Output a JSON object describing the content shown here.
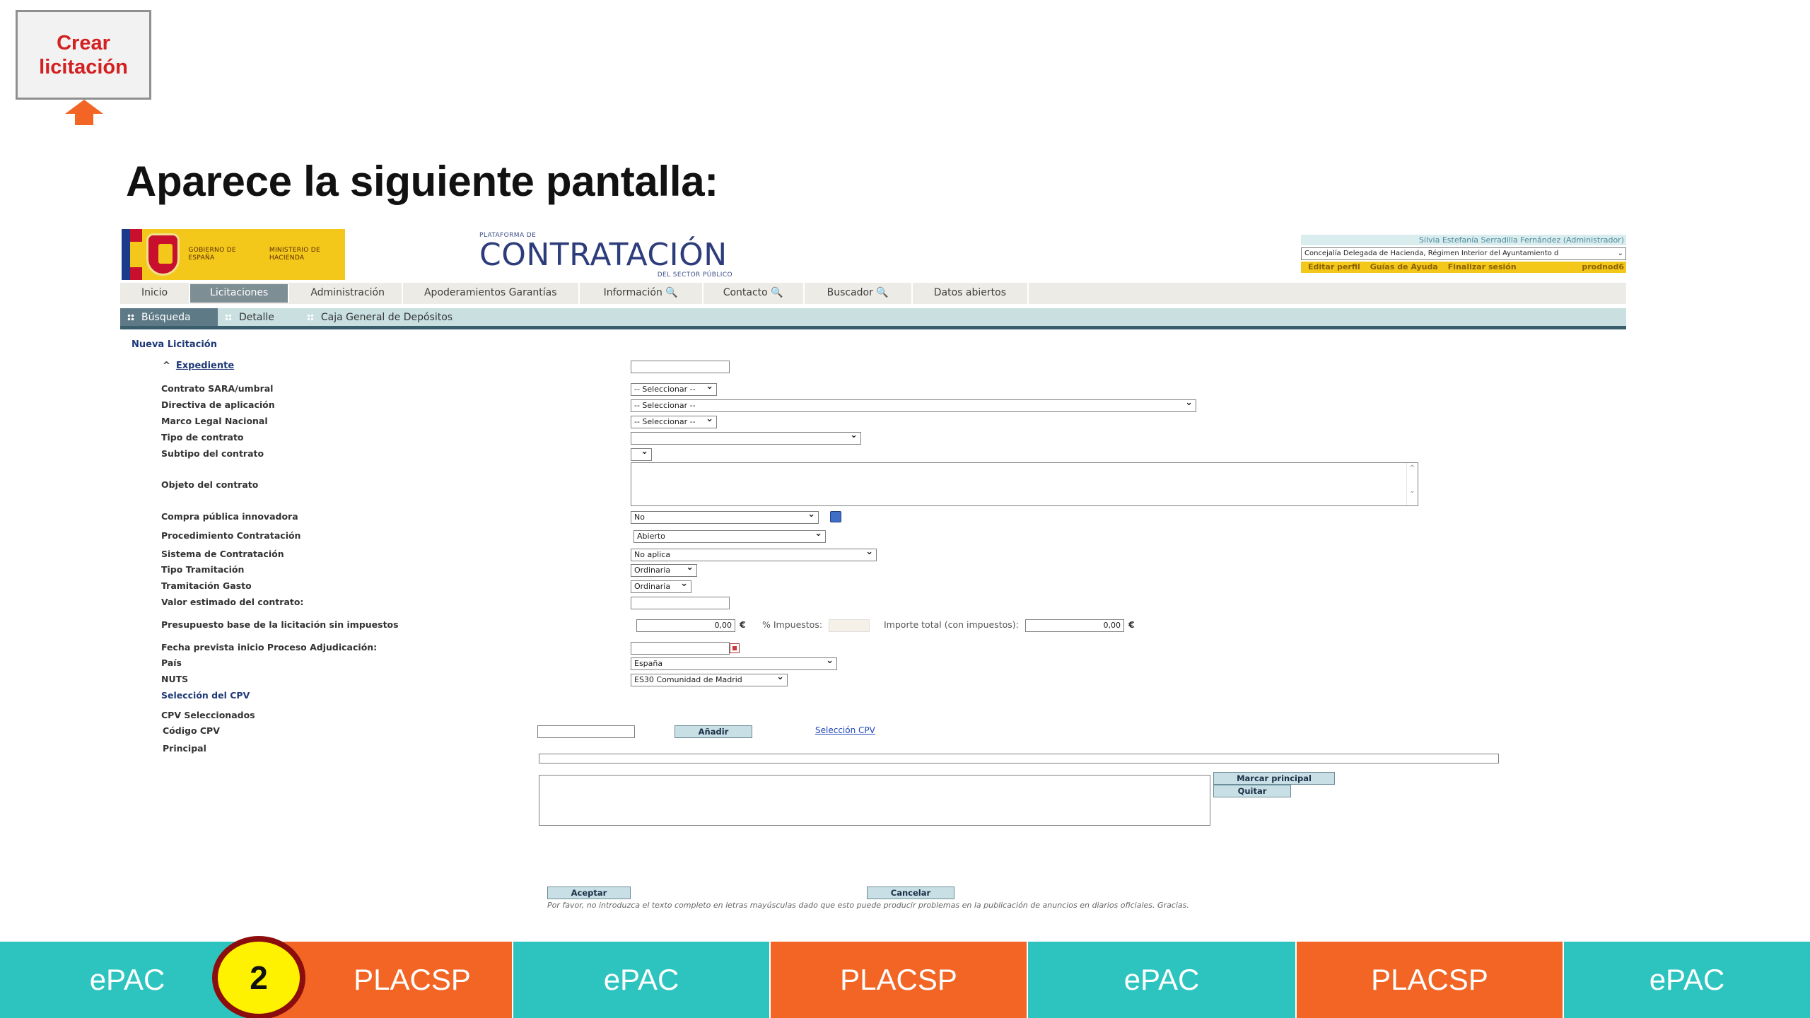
{
  "slide": {
    "create_button": "Crear licitación",
    "title": "Aparece la siguiente pantalla:"
  },
  "app": {
    "gov_line1": "GOBIERNO DE ESPAÑA",
    "gov_line2": "MINISTERIO DE HACIENDA",
    "brand_top": "PLATAFORMA DE",
    "brand_main": "CONTRATACIÓN",
    "brand_bottom": "DEL SECTOR PÚBLICO",
    "user_name": "Silvia Estefanía Serradilla Fernández (Administrador)",
    "org_selected": "Concejalía Delegada de Hacienda, Régimen Interior del Ayuntamiento d",
    "user_links": [
      "Editar perfil",
      "Guías de Ayuda",
      "Finalizar sesión"
    ],
    "user_code": "prodnod6"
  },
  "nav": {
    "tabs": [
      "Inicio",
      "Licitaciones",
      "Administración",
      "Apoderamientos Garantías",
      "Información 🔍",
      "Contacto 🔍",
      "Buscador 🔍",
      "Datos abiertos"
    ],
    "subtabs": [
      "Búsqueda",
      "Detalle",
      "Caja General de Depósitos"
    ]
  },
  "form": {
    "section": "Nueva Licitación",
    "expediente": "Expediente",
    "labels": {
      "sara": "Contrato SARA/umbral",
      "directiva": "Directiva de aplicación",
      "marco": "Marco Legal Nacional",
      "tipo": "Tipo de contrato",
      "subtipo": "Subtipo del contrato",
      "objeto": "Objeto del contrato",
      "compra": "Compra pública innovadora",
      "procedimiento": "Procedimiento Contratación",
      "sistema": "Sistema de Contratación",
      "tramitacion": "Tipo Tramitación",
      "gasto": "Tramitación Gasto",
      "valor": "Valor estimado del contrato:",
      "presupuesto": "Presupuesto base de la licitación sin impuestos",
      "fecha": "Fecha prevista inicio Proceso Adjudicación:",
      "pais": "País",
      "nuts": "NUTS",
      "seleccion_cpv": "Selección del CPV",
      "cpv_sel": "CPV Seleccionados",
      "codigo_cpv": "Código CPV",
      "principal": "Principal",
      "impuestos": "% Impuestos:",
      "importe_total": "Importe total (con impuestos):"
    },
    "values": {
      "seleccionar": "-- Seleccionar --",
      "compra": "No",
      "procedimiento": "Abierto",
      "sistema": "No aplica",
      "tramitacion": "Ordinaria",
      "gasto": "Ordinaria",
      "presupuesto": "0,00",
      "euro": "€",
      "importe_total": "0,00",
      "pais": "España",
      "nuts": "ES30 Comunidad de Madrid"
    },
    "buttons": {
      "anadir": "Añadir",
      "seleccion_cpv": "Selección CPV",
      "marcar_principal": "Marcar principal",
      "quitar": "Quitar",
      "aceptar": "Aceptar",
      "cancelar": "Cancelar"
    },
    "note": "Por favor, no introduzca el texto completo en letras mayúsculas dado que esto puede producir problemas en la publicación de anuncios en diarios oficiales. Gracias."
  },
  "bottom_bar": {
    "segments": [
      "ePAC",
      "PLACSP",
      "ePAC",
      "PLACSP",
      "ePAC",
      "PLACSP",
      "ePAC"
    ],
    "step": "2"
  },
  "colors": {
    "teal": "#2dc4c0",
    "orange": "#f26524",
    "nav_active": "#7e8e95",
    "gov_yellow": "#f3c81b"
  }
}
